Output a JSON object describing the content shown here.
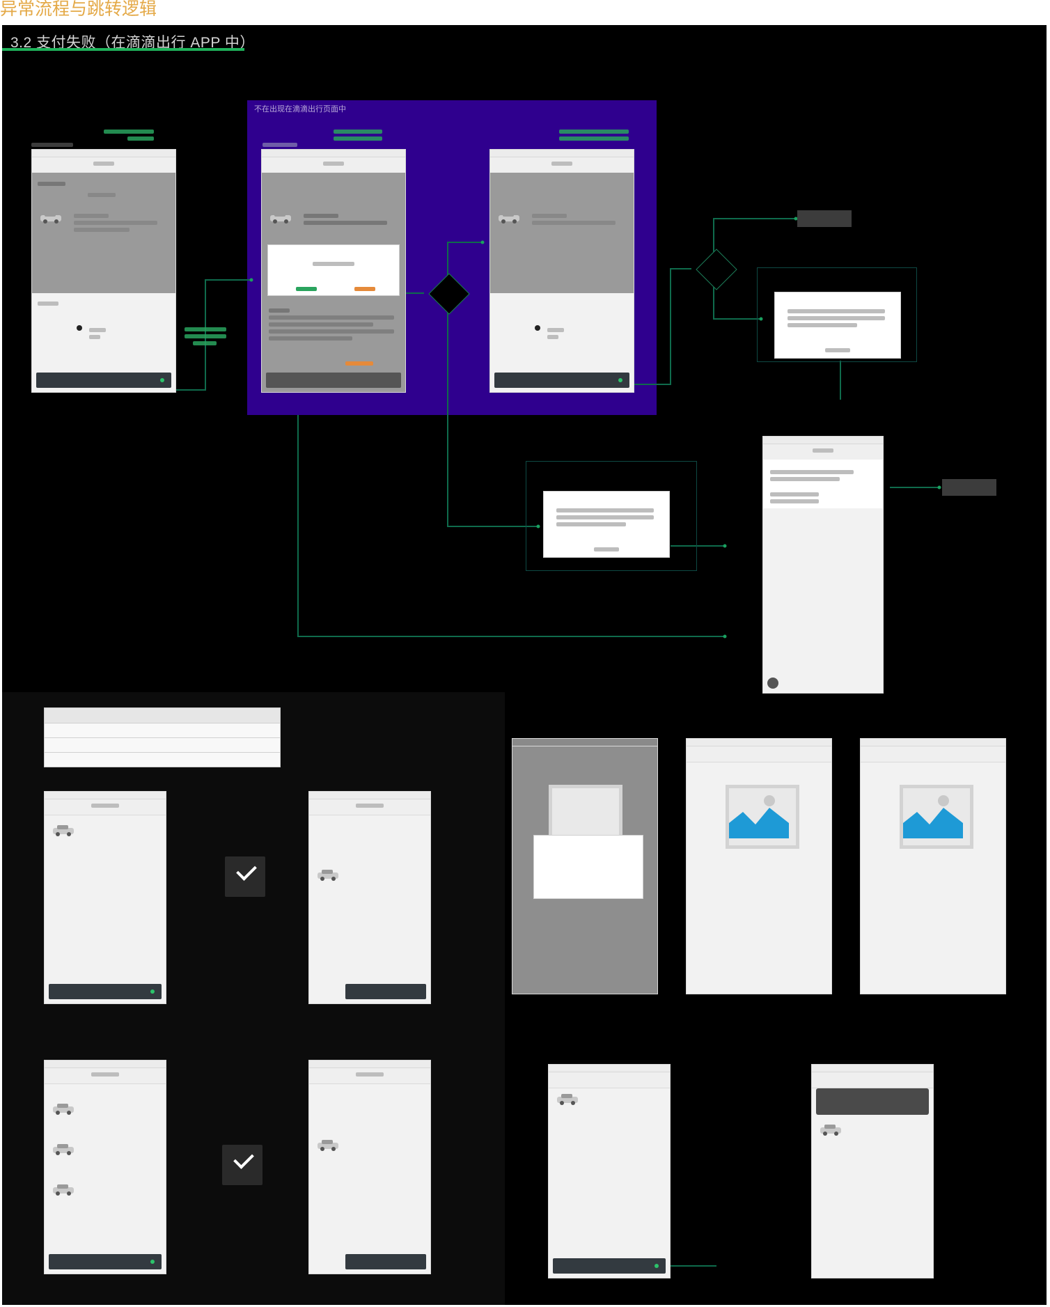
{
  "page": {
    "title": "异常流程与跳转逻辑"
  },
  "board": {
    "section_title": "3.2 支付失败（在滴滴出行 APP 中）",
    "highlight_group_label": "不在出现在滴滴出行页面中"
  },
  "colors": {
    "title_orange": "#e4a947",
    "board_bg": "#000000",
    "accent_green": "#1fb35b",
    "group_purple": "#2f008e",
    "link_blue": "#1e8fd6"
  },
  "icons": [
    "car-icon",
    "checkmark-icon",
    "image-placeholder-icon",
    "radio-dot-icon",
    "avatar-icon"
  ]
}
